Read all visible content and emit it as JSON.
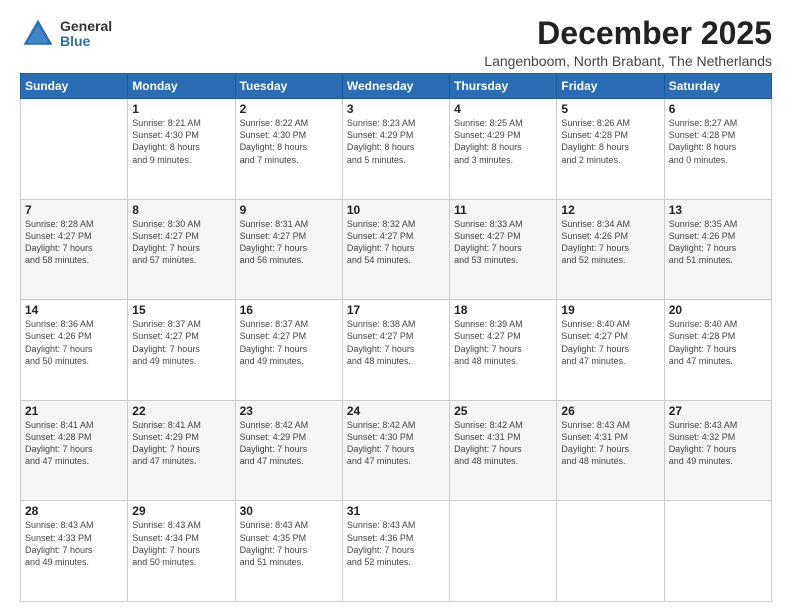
{
  "logo": {
    "general": "General",
    "blue": "Blue"
  },
  "title": "December 2025",
  "subtitle": "Langenboom, North Brabant, The Netherlands",
  "headers": [
    "Sunday",
    "Monday",
    "Tuesday",
    "Wednesday",
    "Thursday",
    "Friday",
    "Saturday"
  ],
  "weeks": [
    [
      {
        "day": "",
        "info": ""
      },
      {
        "day": "1",
        "info": "Sunrise: 8:21 AM\nSunset: 4:30 PM\nDaylight: 8 hours\nand 9 minutes."
      },
      {
        "day": "2",
        "info": "Sunrise: 8:22 AM\nSunset: 4:30 PM\nDaylight: 8 hours\nand 7 minutes."
      },
      {
        "day": "3",
        "info": "Sunrise: 8:23 AM\nSunset: 4:29 PM\nDaylight: 8 hours\nand 5 minutes."
      },
      {
        "day": "4",
        "info": "Sunrise: 8:25 AM\nSunset: 4:29 PM\nDaylight: 8 hours\nand 3 minutes."
      },
      {
        "day": "5",
        "info": "Sunrise: 8:26 AM\nSunset: 4:28 PM\nDaylight: 8 hours\nand 2 minutes."
      },
      {
        "day": "6",
        "info": "Sunrise: 8:27 AM\nSunset: 4:28 PM\nDaylight: 8 hours\nand 0 minutes."
      }
    ],
    [
      {
        "day": "7",
        "info": "Sunrise: 8:28 AM\nSunset: 4:27 PM\nDaylight: 7 hours\nand 58 minutes."
      },
      {
        "day": "8",
        "info": "Sunrise: 8:30 AM\nSunset: 4:27 PM\nDaylight: 7 hours\nand 57 minutes."
      },
      {
        "day": "9",
        "info": "Sunrise: 8:31 AM\nSunset: 4:27 PM\nDaylight: 7 hours\nand 56 minutes."
      },
      {
        "day": "10",
        "info": "Sunrise: 8:32 AM\nSunset: 4:27 PM\nDaylight: 7 hours\nand 54 minutes."
      },
      {
        "day": "11",
        "info": "Sunrise: 8:33 AM\nSunset: 4:27 PM\nDaylight: 7 hours\nand 53 minutes."
      },
      {
        "day": "12",
        "info": "Sunrise: 8:34 AM\nSunset: 4:26 PM\nDaylight: 7 hours\nand 52 minutes."
      },
      {
        "day": "13",
        "info": "Sunrise: 8:35 AM\nSunset: 4:26 PM\nDaylight: 7 hours\nand 51 minutes."
      }
    ],
    [
      {
        "day": "14",
        "info": "Sunrise: 8:36 AM\nSunset: 4:26 PM\nDaylight: 7 hours\nand 50 minutes."
      },
      {
        "day": "15",
        "info": "Sunrise: 8:37 AM\nSunset: 4:27 PM\nDaylight: 7 hours\nand 49 minutes."
      },
      {
        "day": "16",
        "info": "Sunrise: 8:37 AM\nSunset: 4:27 PM\nDaylight: 7 hours\nand 49 minutes."
      },
      {
        "day": "17",
        "info": "Sunrise: 8:38 AM\nSunset: 4:27 PM\nDaylight: 7 hours\nand 48 minutes."
      },
      {
        "day": "18",
        "info": "Sunrise: 8:39 AM\nSunset: 4:27 PM\nDaylight: 7 hours\nand 48 minutes."
      },
      {
        "day": "19",
        "info": "Sunrise: 8:40 AM\nSunset: 4:27 PM\nDaylight: 7 hours\nand 47 minutes."
      },
      {
        "day": "20",
        "info": "Sunrise: 8:40 AM\nSunset: 4:28 PM\nDaylight: 7 hours\nand 47 minutes."
      }
    ],
    [
      {
        "day": "21",
        "info": "Sunrise: 8:41 AM\nSunset: 4:28 PM\nDaylight: 7 hours\nand 47 minutes."
      },
      {
        "day": "22",
        "info": "Sunrise: 8:41 AM\nSunset: 4:29 PM\nDaylight: 7 hours\nand 47 minutes."
      },
      {
        "day": "23",
        "info": "Sunrise: 8:42 AM\nSunset: 4:29 PM\nDaylight: 7 hours\nand 47 minutes."
      },
      {
        "day": "24",
        "info": "Sunrise: 8:42 AM\nSunset: 4:30 PM\nDaylight: 7 hours\nand 47 minutes."
      },
      {
        "day": "25",
        "info": "Sunrise: 8:42 AM\nSunset: 4:31 PM\nDaylight: 7 hours\nand 48 minutes."
      },
      {
        "day": "26",
        "info": "Sunrise: 8:43 AM\nSunset: 4:31 PM\nDaylight: 7 hours\nand 48 minutes."
      },
      {
        "day": "27",
        "info": "Sunrise: 8:43 AM\nSunset: 4:32 PM\nDaylight: 7 hours\nand 49 minutes."
      }
    ],
    [
      {
        "day": "28",
        "info": "Sunrise: 8:43 AM\nSunset: 4:33 PM\nDaylight: 7 hours\nand 49 minutes."
      },
      {
        "day": "29",
        "info": "Sunrise: 8:43 AM\nSunset: 4:34 PM\nDaylight: 7 hours\nand 50 minutes."
      },
      {
        "day": "30",
        "info": "Sunrise: 8:43 AM\nSunset: 4:35 PM\nDaylight: 7 hours\nand 51 minutes."
      },
      {
        "day": "31",
        "info": "Sunrise: 8:43 AM\nSunset: 4:36 PM\nDaylight: 7 hours\nand 52 minutes."
      },
      {
        "day": "",
        "info": ""
      },
      {
        "day": "",
        "info": ""
      },
      {
        "day": "",
        "info": ""
      }
    ]
  ]
}
